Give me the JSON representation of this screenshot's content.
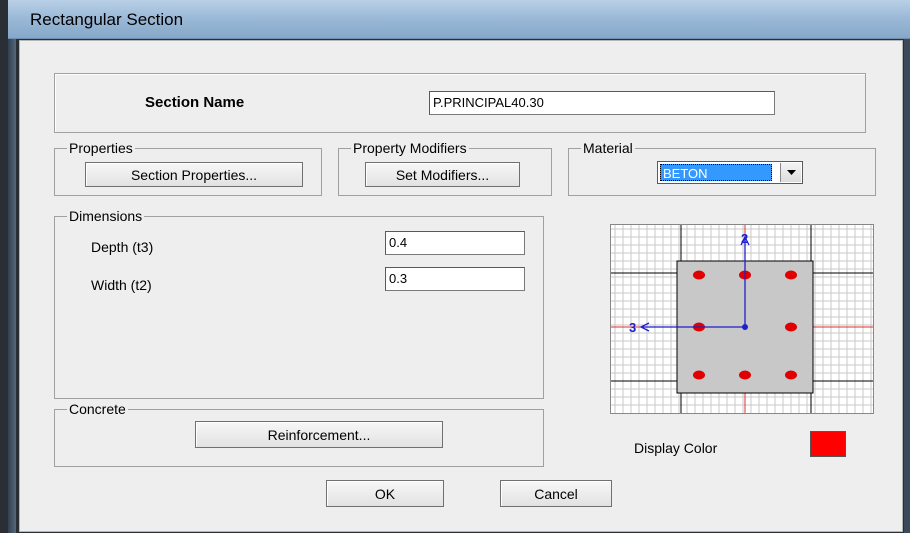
{
  "window": {
    "title": "Rectangular Section"
  },
  "section": {
    "name_label": "Section Name",
    "name_value": "P.PRINCIPAL40.30"
  },
  "properties": {
    "group_label": "Properties",
    "button_label": "Section Properties..."
  },
  "modifiers": {
    "group_label": "Property Modifiers",
    "button_label": "Set Modifiers..."
  },
  "material": {
    "group_label": "Material",
    "selected": "BETON"
  },
  "dimensions": {
    "group_label": "Dimensions",
    "depth_label": "Depth  (t3)",
    "depth_value": "0.4",
    "width_label": "Width  (t2)",
    "width_value": "0.3"
  },
  "preview": {
    "axis_2_label": "2",
    "axis_3_label": "3"
  },
  "concrete": {
    "group_label": "Concrete",
    "button_label": "Reinforcement..."
  },
  "display_color": {
    "label": "Display Color",
    "color": "#ff0000"
  },
  "buttons": {
    "ok": "OK",
    "cancel": "Cancel"
  },
  "colors": {
    "rebar": "#e00000",
    "axis": "#1f1fcc",
    "section_fill": "#c8c8c8",
    "grid": "#c8c8c8"
  }
}
